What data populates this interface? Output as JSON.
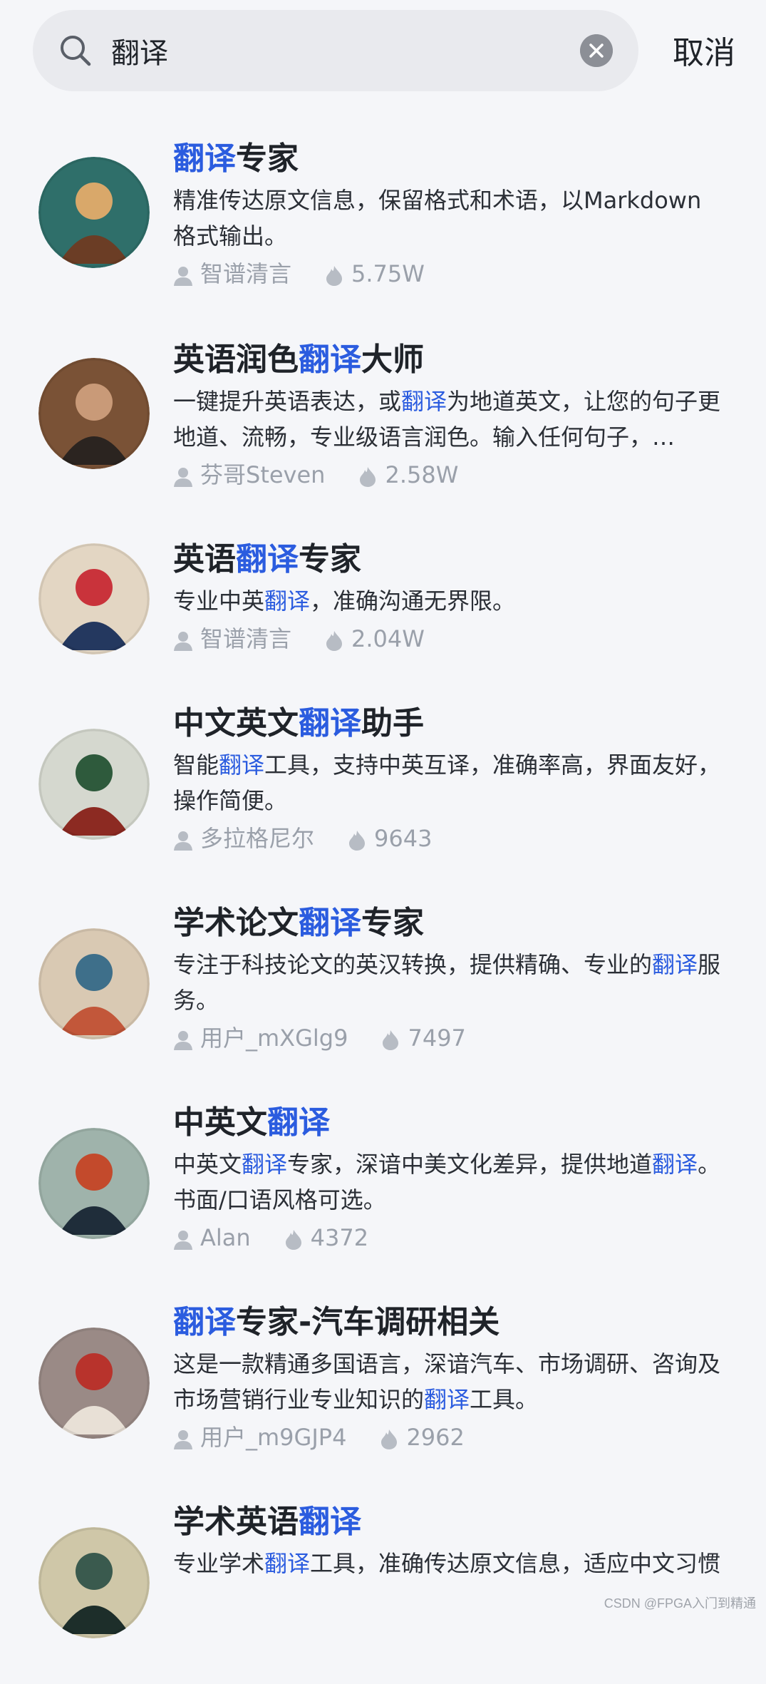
{
  "search": {
    "query": "翻译",
    "cancel_label": "取消"
  },
  "results": [
    {
      "title_parts": [
        {
          "t": "翻译",
          "hl": true
        },
        {
          "t": "专家",
          "hl": false
        }
      ],
      "desc_parts": [
        {
          "t": "精准传达原文信息，保留格式和术语，以Markdown格式输出。",
          "hl": false
        }
      ],
      "author": "智谱清言",
      "count": "5.75W",
      "avatar": {
        "bg": "#2f6f6a",
        "fg": "#d9a86a",
        "accent": "#6b3d25"
      }
    },
    {
      "title_parts": [
        {
          "t": "英语润色",
          "hl": false
        },
        {
          "t": "翻译",
          "hl": true
        },
        {
          "t": "大师",
          "hl": false
        }
      ],
      "desc_parts": [
        {
          "t": "一键提升英语表达，或",
          "hl": false
        },
        {
          "t": "翻译",
          "hl": true
        },
        {
          "t": "为地道英文，让您的句子更地道、流畅，专业级语言润色。输入任何句子，…",
          "hl": false
        }
      ],
      "author": "芬哥Steven",
      "count": "2.58W",
      "avatar": {
        "bg": "#7a5236",
        "fg": "#c99a78",
        "accent": "#2b2420"
      }
    },
    {
      "title_parts": [
        {
          "t": "英语",
          "hl": false
        },
        {
          "t": "翻译",
          "hl": true
        },
        {
          "t": "专家",
          "hl": false
        }
      ],
      "desc_parts": [
        {
          "t": "专业中英",
          "hl": false
        },
        {
          "t": "翻译",
          "hl": true
        },
        {
          "t": "，准确沟通无界限。",
          "hl": false
        }
      ],
      "author": "智谱清言",
      "count": "2.04W",
      "avatar": {
        "bg": "#e3d6c3",
        "fg": "#c9333b",
        "accent": "#24385f"
      }
    },
    {
      "title_parts": [
        {
          "t": "中文英文",
          "hl": false
        },
        {
          "t": "翻译",
          "hl": true
        },
        {
          "t": "助手",
          "hl": false
        }
      ],
      "desc_parts": [
        {
          "t": "智能",
          "hl": false
        },
        {
          "t": "翻译",
          "hl": true
        },
        {
          "t": "工具，支持中英互译，准确率高，界面友好，操作简便。",
          "hl": false
        }
      ],
      "author": "多拉格尼尔",
      "count": "9643",
      "avatar": {
        "bg": "#d5d8cf",
        "fg": "#2e5a3c",
        "accent": "#8c2a22"
      }
    },
    {
      "title_parts": [
        {
          "t": "学术论文",
          "hl": false
        },
        {
          "t": "翻译",
          "hl": true
        },
        {
          "t": "专家",
          "hl": false
        }
      ],
      "desc_parts": [
        {
          "t": "专注于科技论文的英汉转换，提供精确、专业的",
          "hl": false
        },
        {
          "t": "翻译",
          "hl": true
        },
        {
          "t": "服务。",
          "hl": false
        }
      ],
      "author": "用户_mXGlg9",
      "count": "7497",
      "avatar": {
        "bg": "#d9c9b3",
        "fg": "#3e6f8a",
        "accent": "#c2573a"
      }
    },
    {
      "title_parts": [
        {
          "t": "中英文",
          "hl": false
        },
        {
          "t": "翻译",
          "hl": true
        }
      ],
      "desc_parts": [
        {
          "t": "中英文",
          "hl": false
        },
        {
          "t": "翻译",
          "hl": true
        },
        {
          "t": "专家，深谙中美文化差异，提供地道",
          "hl": false
        },
        {
          "t": "翻译",
          "hl": true
        },
        {
          "t": "。书面/口语风格可选。",
          "hl": false
        }
      ],
      "author": "Alan",
      "count": "4372",
      "avatar": {
        "bg": "#9fb3ab",
        "fg": "#c34a2c",
        "accent": "#1f2d3a"
      }
    },
    {
      "title_parts": [
        {
          "t": "翻译",
          "hl": true
        },
        {
          "t": "专家-汽车调研相关",
          "hl": false
        }
      ],
      "desc_parts": [
        {
          "t": "这是一款精通多国语言，深谙汽车、市场调研、咨询及市场营销行业专业知识的",
          "hl": false
        },
        {
          "t": "翻译",
          "hl": true
        },
        {
          "t": "工具。",
          "hl": false
        }
      ],
      "author": "用户_m9GJP4",
      "count": "2962",
      "avatar": {
        "bg": "#9a8a86",
        "fg": "#b8332c",
        "accent": "#e8e0d6"
      }
    },
    {
      "title_parts": [
        {
          "t": "学术英语",
          "hl": false
        },
        {
          "t": "翻译",
          "hl": true
        }
      ],
      "desc_parts": [
        {
          "t": "专业学术",
          "hl": false
        },
        {
          "t": "翻译",
          "hl": true
        },
        {
          "t": "工具，准确传达原文信息，适应中文习惯",
          "hl": false
        }
      ],
      "author": "",
      "count": "",
      "avatar": {
        "bg": "#cfc7a8",
        "fg": "#3a5a4e",
        "accent": "#1d2e2a"
      }
    }
  ],
  "watermark": "CSDN @FPGA入门到精通"
}
